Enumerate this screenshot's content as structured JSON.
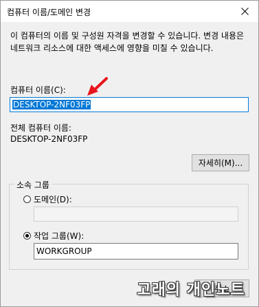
{
  "window": {
    "title": "컴퓨터 이름/도메인 변경"
  },
  "description": "이 컴퓨터의 이름 및 구성원 자격을 변경할 수 있습니다. 변경 내용은 네트워크 리소스에 대한 액세스에 영향을 미칠 수 있습니다.",
  "computer_name": {
    "label": "컴퓨터 이름(C):",
    "value": "DESKTOP-2NF03FP"
  },
  "full_name": {
    "label": "전체 컴퓨터 이름:",
    "value": "DESKTOP-2NF03FP"
  },
  "more_button": {
    "label": "자세히(M)..."
  },
  "membership": {
    "legend": "소속 그룹",
    "domain": {
      "label": "도메인(D):",
      "value": "",
      "selected": false
    },
    "workgroup": {
      "label": "작업 그룹(W):",
      "value": "WORKGROUP",
      "selected": true
    }
  },
  "cancel_button": {
    "label": "취소"
  },
  "watermark": {
    "text": "고래의 개인노트"
  },
  "colors": {
    "accent": "#0078d7",
    "annotation_arrow": "#e8141c"
  },
  "icons": {
    "close": "close-icon",
    "annotation": "red-arrow-annotation"
  }
}
